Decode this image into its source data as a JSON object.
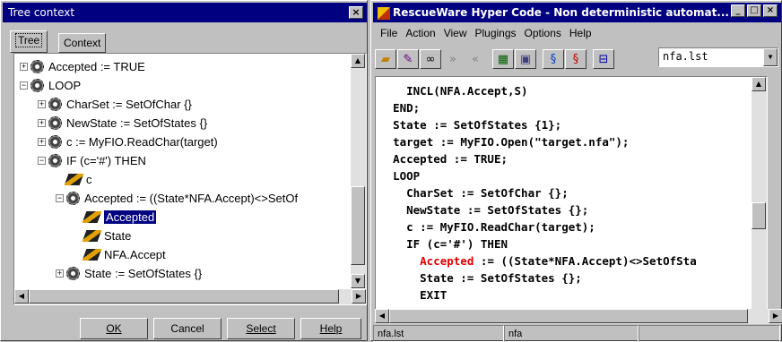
{
  "left_window": {
    "title": "Tree context",
    "close": "×",
    "tabs": [
      "Tree",
      "Context"
    ],
    "tree": [
      {
        "indent": 0,
        "expander": "+",
        "icon": "gear-icon",
        "text": "Accepted := TRUE"
      },
      {
        "indent": 0,
        "expander": "−",
        "icon": "gear-icon",
        "text": "LOOP"
      },
      {
        "indent": 1,
        "expander": "+",
        "icon": "gear-icon",
        "text": "CharSet := SetOfChar {}"
      },
      {
        "indent": 1,
        "expander": "+",
        "icon": "gear-icon",
        "text": "NewState := SetOfStates {}"
      },
      {
        "indent": 1,
        "expander": "+",
        "icon": "gear-icon",
        "text": "c := MyFIO.ReadChar(target)"
      },
      {
        "indent": 1,
        "expander": "−",
        "icon": "gear-icon",
        "text": "IF (c='#') THEN"
      },
      {
        "indent": 2,
        "expander": "",
        "icon": "leaf-icon",
        "text": "c"
      },
      {
        "indent": 2,
        "expander": "−",
        "icon": "gear-icon",
        "text": "Accepted := ((State*NFA.Accept)<>SetOf"
      },
      {
        "indent": 3,
        "expander": "",
        "icon": "leaf-icon",
        "text": "Accepted",
        "selected": true
      },
      {
        "indent": 3,
        "expander": "",
        "icon": "leaf-icon",
        "text": "State"
      },
      {
        "indent": 3,
        "expander": "",
        "icon": "leaf-icon",
        "text": "NFA.Accept"
      },
      {
        "indent": 2,
        "expander": "+",
        "icon": "gear-icon",
        "text": "State := SetOfStates {}"
      }
    ],
    "buttons": {
      "ok": "OK",
      "cancel": "Cancel",
      "select": "Select",
      "help": "Help"
    }
  },
  "right_window": {
    "title": "RescueWare Hyper Code - Non deterministic automat...",
    "menu": [
      "File",
      "Action",
      "View",
      "Plugings",
      "Options",
      "Help"
    ],
    "file_select": "nfa.lst",
    "code_lines": [
      {
        "indent": "    ",
        "text": "INCL(NFA.Accept,S)"
      },
      {
        "indent": "  ",
        "text": "END;"
      },
      {
        "indent": "  ",
        "text": "State := SetOfStates {1};"
      },
      {
        "indent": "  ",
        "text": "target := MyFIO.Open(\"target.nfa\");"
      },
      {
        "indent": "  ",
        "text": "Accepted := TRUE;"
      },
      {
        "indent": "  ",
        "text": "LOOP"
      },
      {
        "indent": "    ",
        "text": "CharSet := SetOfChar {};"
      },
      {
        "indent": "    ",
        "text": "NewState := SetOfStates {};"
      },
      {
        "indent": "    ",
        "text": "c := MyFIO.ReadChar(target);"
      },
      {
        "indent": "    ",
        "text": "IF (c='#') THEN"
      },
      {
        "indent": "      ",
        "highlight": "Accepted",
        "text": " := ((State*NFA.Accept)<>SetOfSta"
      },
      {
        "indent": "      ",
        "text": "State := SetOfStates {};"
      },
      {
        "indent": "      ",
        "text": "EXIT"
      }
    ],
    "status": [
      "nfa.lst",
      "nfa"
    ]
  }
}
